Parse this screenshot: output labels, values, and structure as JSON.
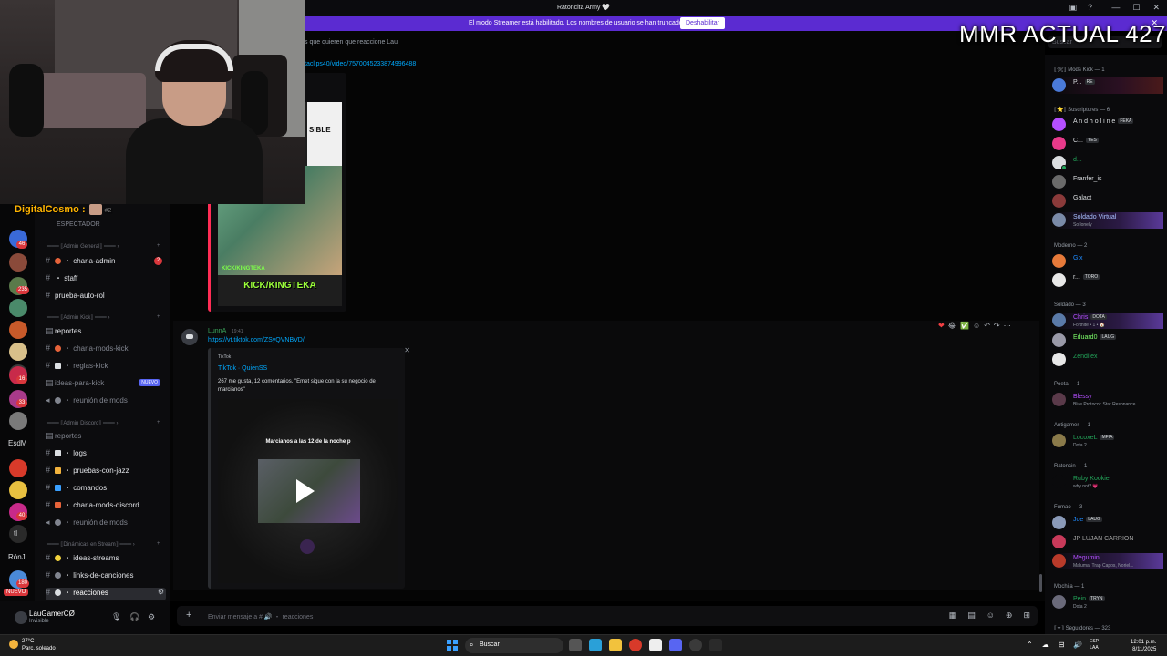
{
  "window": {
    "title": "Ratoncita Army 🤍",
    "controls": [
      "—",
      "☐",
      "✕"
    ],
    "title_icons": [
      "▣",
      "?",
      "⇩"
    ]
  },
  "banner": {
    "text": "El modo Streamer está habilitado. Los nombres de usuario se han truncado.",
    "button": "Deshabilitar",
    "close": "✕"
  },
  "overlay": {
    "mmr": "MMR ACTUAL 427",
    "chatter": "DigitalCosmo :",
    "chatter_sub": "#2"
  },
  "chat": {
    "topic": "s que quieren que reaccione Lau",
    "search_placeholder": "Buscar",
    "link1": "taclips40/video/7570045233874996488",
    "embed1": {
      "text_top": "SIBLE",
      "label1": "KICK/KINGTEKA",
      "label2": "KICK/KINGTEKA"
    },
    "message2": {
      "author": "LunnA",
      "time": "19:41",
      "link": "https://vt.tiktok.com/ZSyQVNBVD/",
      "embed": {
        "provider": "TikTok",
        "title": "TikTok · QuienSS",
        "description": "267 me gusta, 12 comentarios. \"Emet sigue con la su negocio de marcianos\"",
        "video_caption": "Marcianos a las 12 de la noche p"
      }
    },
    "hover_actions": [
      "❤",
      "😂",
      "✅",
      "☺",
      "↶",
      "↷",
      "⋯"
    ],
    "composer_placeholder": "Enviar mensaje a # 🔊 ・ reacciones",
    "composer_tools": [
      "▦",
      "▤",
      "☺",
      "⊕",
      "⊞"
    ]
  },
  "rail": {
    "badges": [
      "46",
      "235",
      "16",
      "33",
      "40",
      "180"
    ],
    "labels": [
      "EsdM",
      "tl",
      "RónJ"
    ],
    "nuevo": "NUEVO"
  },
  "channels": {
    "top_item": "ESPECTADOR",
    "categories": [
      "═══ ⟦Admin General⟧ ═══ ›",
      "═══ ⟦Admin Kick⟧ ═══ ›",
      "═══ ⟦Admin Discord⟧ ═══ ›",
      "═══ ⟦Dinámicas en Stream⟧ ═══ ›"
    ],
    "items": [
      {
        "label": "・ charla-admin",
        "count": "2"
      },
      {
        "label": "・ staff"
      },
      {
        "label": "prueba-auto-rol"
      },
      {
        "label": "reportes"
      },
      {
        "label": "・ charla-mods-kick"
      },
      {
        "label": "・ reglas-kick"
      },
      {
        "label": "ideas-para-kick",
        "badge": "NUEVO"
      },
      {
        "label": "・ reunión de mods"
      },
      {
        "label": "reportes"
      },
      {
        "label": "・ logs"
      },
      {
        "label": "・ pruebas-con-jazz"
      },
      {
        "label": "・ comandos"
      },
      {
        "label": "・ charla-mods-discord"
      },
      {
        "label": "・ reunión de mods"
      },
      {
        "label": "・ ideas-streams"
      },
      {
        "label": "・ links-de-canciones"
      },
      {
        "label": "・ reacciones"
      }
    ]
  },
  "user": {
    "name": "LauGamerCØ",
    "status": "Invisible",
    "controls": [
      "🎙",
      "🎧",
      "⚙"
    ]
  },
  "members": {
    "groups": [
      "⟦🛠⟧ Mods Kick — 1",
      "⟦⭐⟧ Suscriptores — 6",
      "Moderno — 2",
      "Soldado — 3",
      "Poeta — 1",
      "Antigamer — 1",
      "Ratoncin — 1",
      "Fumao — 3",
      "Mochila — 1",
      "⟦✦⟧ Seguidores — 323"
    ],
    "list": [
      {
        "name": "P...",
        "tag": "RE",
        "color": "#dbdee1"
      },
      {
        "name": "A n d h o l i n e",
        "tag": "FEKA",
        "color": "#dbdee1"
      },
      {
        "name": "C...",
        "tag": "YES",
        "color": "#dbdee1"
      },
      {
        "name": "d...",
        "color": "#23a55a"
      },
      {
        "name": "Franfer_is",
        "color": "#dbdee1"
      },
      {
        "name": "Galact",
        "color": "#dbdee1"
      },
      {
        "name": "Soldado Virtual",
        "activity": "So lonely",
        "color": "#a9c1ff"
      },
      {
        "name": "Gix",
        "color": "#1f8bff"
      },
      {
        "name": "r...",
        "tag": "TORO",
        "color": "#dbdee1"
      },
      {
        "name": "Chris",
        "tag": "DOTA",
        "activity": "Fortnite • 1 • 🏠",
        "color": "#b44fff"
      },
      {
        "name": "Eduard0",
        "tag": "LAUG",
        "color": "#7dff6a"
      },
      {
        "name": "Zendilex",
        "color": "#23a55a"
      },
      {
        "name": "Blessy",
        "activity": "Blue Protocol: Star Resonance",
        "color": "#b44fff"
      },
      {
        "name": "LocoxeL",
        "tag": "MFIA",
        "activity": "Dota 2",
        "color": "#23a55a"
      },
      {
        "name": "Ruby Kookie",
        "activity": "why not? 💗",
        "color": "#23a55a"
      },
      {
        "name": "Joe",
        "tag": "LAUG",
        "color": "#1f8bff"
      },
      {
        "name": "JP LUJAN CARRION",
        "color": "#a2a2a2"
      },
      {
        "name": "Megumin",
        "activity": "Maluma, Trap Capos, Noriel...",
        "color": "#b44fff"
      },
      {
        "name": "Pein",
        "tag": "TRYN",
        "activity": "Dota 2",
        "color": "#23a55a"
      }
    ]
  },
  "taskbar": {
    "temp": "27°C",
    "weather": "Parc. soleado",
    "search": "Buscar",
    "lang_top": "ESP",
    "lang_bottom": "LAA",
    "time": "12:01 p.m.",
    "date": "8/11/2025",
    "tray": [
      "⌃",
      "☁",
      "⊟",
      "🔊",
      "🔋"
    ]
  },
  "colors": {
    "banner": "#5b2bd1",
    "link": "#00a8fc",
    "online": "#23a55a",
    "badge": "#da373c"
  }
}
